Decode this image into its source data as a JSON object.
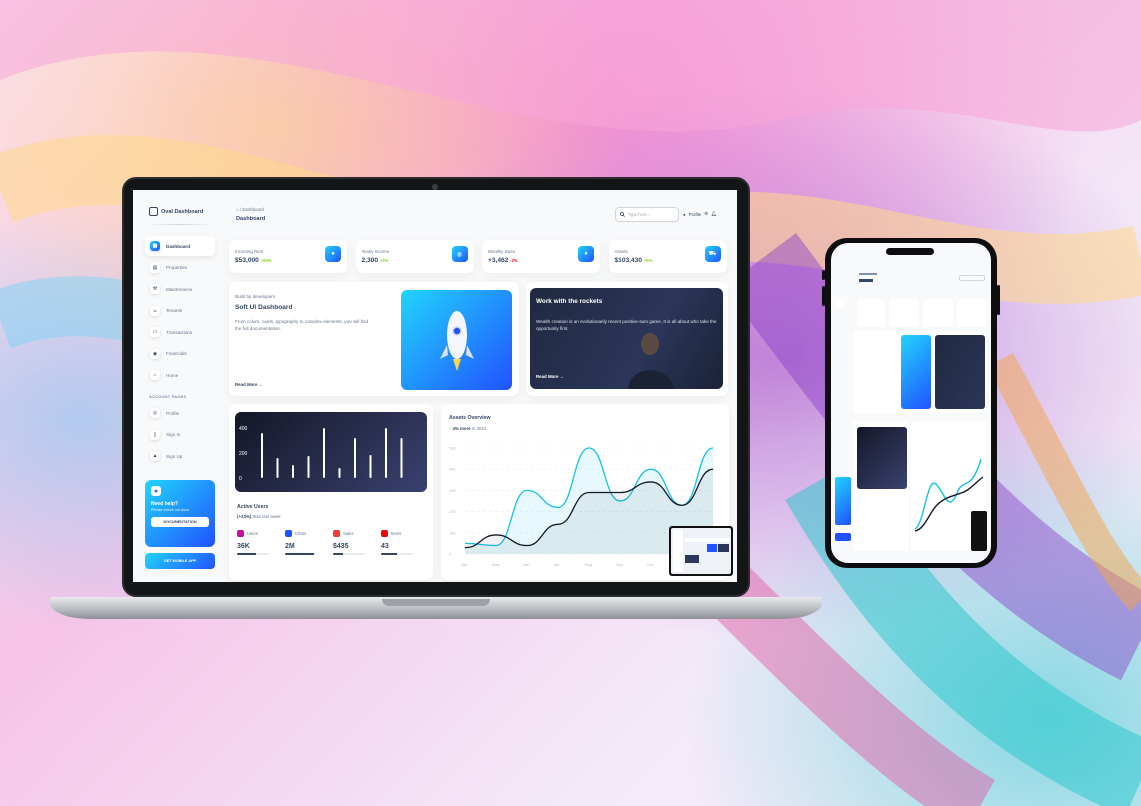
{
  "app": {
    "brand": "Oval Dashboard"
  },
  "sidebar": {
    "items": [
      {
        "label": "Dashboard",
        "icon": "grid-icon",
        "active": true
      },
      {
        "label": "Properties",
        "icon": "building-icon"
      },
      {
        "label": "Maintenance",
        "icon": "wrench-icon"
      },
      {
        "label": "Tenants",
        "icon": "users-icon"
      },
      {
        "label": "Transactions",
        "icon": "receipt-icon"
      },
      {
        "label": "Financials",
        "icon": "coins-icon"
      },
      {
        "label": "Home",
        "icon": "home-icon"
      }
    ],
    "section_label": "ACCOUNT PAGES",
    "account_items": [
      {
        "label": "Profile",
        "icon": "user-icon"
      },
      {
        "label": "Sign In",
        "icon": "document-icon"
      },
      {
        "label": "Sign Up",
        "icon": "rocket-icon"
      }
    ],
    "help": {
      "title": "Need help?",
      "subtitle": "Please check our docs",
      "button": "DOCUMENTATION"
    },
    "mobile_button": "GET MOBILE APP"
  },
  "topbar": {
    "breadcrumb_home": "⌂",
    "breadcrumb_sep": "/",
    "breadcrumb_current": "Dashboard",
    "title": "Dashboard",
    "search_placeholder": "Type here...",
    "profile_label": "Profile"
  },
  "stats": [
    {
      "label": "Incoming Rent",
      "value": "$53,000",
      "change": "+55%",
      "trend": "pos",
      "icon": "coin-icon"
    },
    {
      "label": "Yearly Income",
      "value": "2,300",
      "change": "+3%",
      "trend": "pos",
      "icon": "globe-icon"
    },
    {
      "label": "Monthly Dues",
      "value": "+3,462",
      "change": "-2%",
      "trend": "neg",
      "icon": "bulb-icon"
    },
    {
      "label": "Assets",
      "value": "$103,430",
      "change": "+5%",
      "trend": "pos",
      "icon": "cart-icon"
    }
  ],
  "build": {
    "kicker": "Build by developers",
    "title": "Soft UI Dashboard",
    "text": "From colors, cards, typography to complex elements, you will find the full documentation.",
    "link": "Read More →"
  },
  "work": {
    "title": "Work with the rockets",
    "text": "Wealth creation is an evolutionarily recent positive-sum game. It is all about who take the opportunity first.",
    "link": "Read More →"
  },
  "active_users": {
    "title": "Active Users",
    "sub_bold": "(+23%)",
    "sub_rest": " than last week",
    "metrics": [
      {
        "label": "Users",
        "value": "36K",
        "color": "#cb0c9f",
        "progress": 0.6
      },
      {
        "label": "Clicks",
        "value": "2M",
        "color": "#2152ff",
        "progress": 0.9
      },
      {
        "label": "Sales",
        "value": "$435",
        "color": "#f53939",
        "progress": 0.3
      },
      {
        "label": "Items",
        "value": "43",
        "color": "#ea0606",
        "progress": 0.5
      }
    ]
  },
  "overview": {
    "title": "Assets Overview",
    "sub_bold": "4% more",
    "sub_rest": " in 2021"
  },
  "chart_data": [
    {
      "type": "bar",
      "title": "",
      "ylim": [
        0,
        500
      ],
      "yticks": [
        "400",
        "200",
        "0"
      ],
      "values": [
        450,
        200,
        130,
        220,
        500,
        100,
        400,
        230,
        500,
        400
      ]
    },
    {
      "type": "line",
      "title": "Assets Overview",
      "categories": [
        "Apr",
        "May",
        "Jun",
        "Jul",
        "Aug",
        "Sep",
        "Oct",
        "Nov",
        "Dec"
      ],
      "ylim": [
        0,
        500
      ],
      "yticks": [
        "500",
        "400",
        "300",
        "200",
        "100",
        "0"
      ],
      "series": [
        {
          "color": "#17c1e8",
          "values": [
            50,
            40,
            300,
            220,
            500,
            250,
            400,
            230,
            500
          ]
        },
        {
          "color": "#141727",
          "values": [
            30,
            90,
            40,
            140,
            290,
            290,
            340,
            230,
            400
          ]
        }
      ],
      "grid": true
    }
  ]
}
